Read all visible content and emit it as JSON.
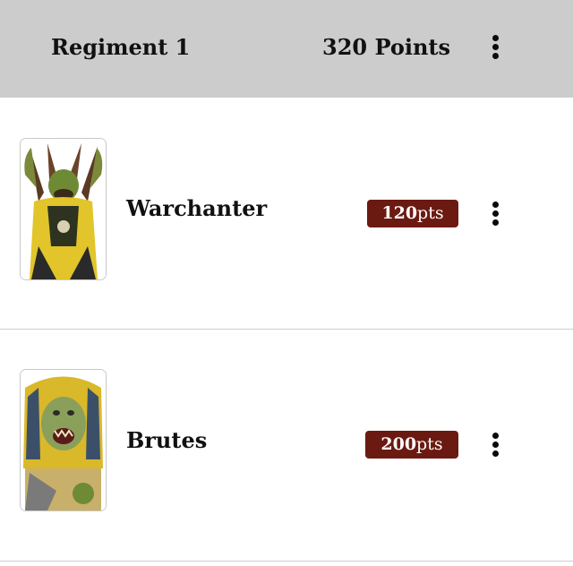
{
  "header": {
    "title": "Regiment 1",
    "points": "320 Points"
  },
  "units": [
    {
      "name": "Warchanter",
      "points": "120",
      "suffix": "pts"
    },
    {
      "name": "Brutes",
      "points": "200",
      "suffix": "pts"
    }
  ]
}
